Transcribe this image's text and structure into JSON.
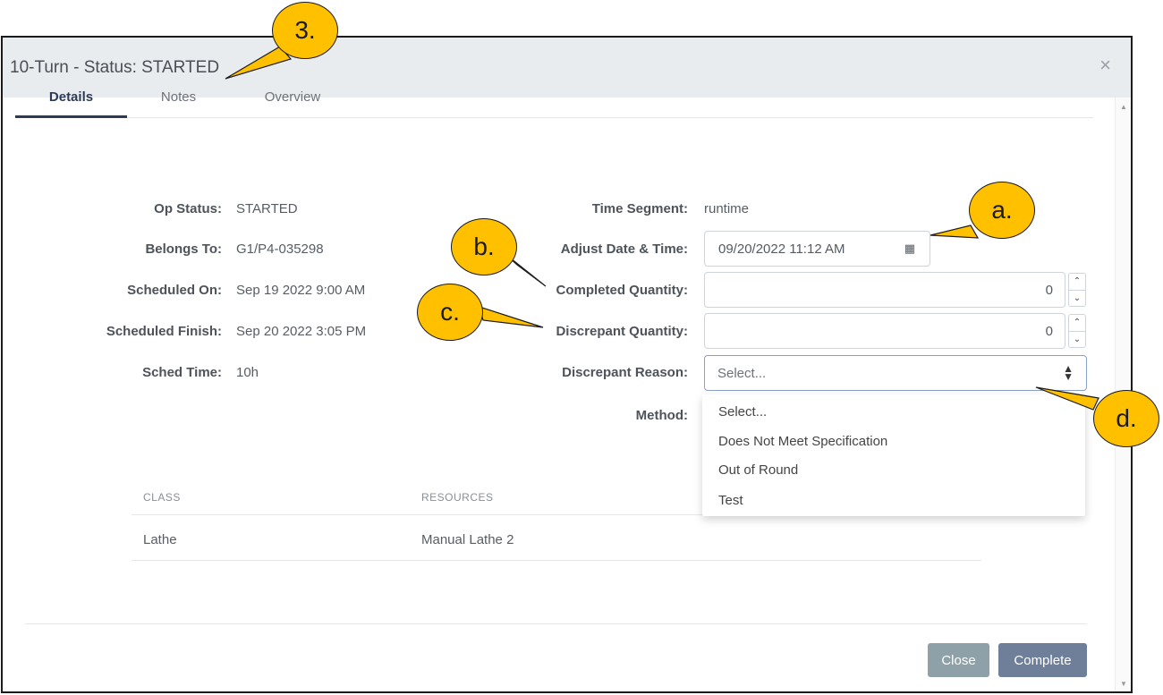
{
  "modal": {
    "title": "10-Turn - Status: STARTED",
    "close_icon": "×"
  },
  "tabs": [
    {
      "label": "Details",
      "active": true
    },
    {
      "label": "Notes",
      "active": false
    },
    {
      "label": "Overview",
      "active": false
    }
  ],
  "details_left": {
    "op_status_label": "Op Status:",
    "op_status_value": "STARTED",
    "belongs_to_label": "Belongs To:",
    "belongs_to_value": "G1/P4-035298",
    "scheduled_on_label": "Scheduled On:",
    "scheduled_on_value": "Sep 19 2022 9:00 AM",
    "scheduled_finish_label": "Scheduled Finish:",
    "scheduled_finish_value": "Sep 20 2022 3:05 PM",
    "sched_time_label": "Sched Time:",
    "sched_time_value": "10h"
  },
  "details_right": {
    "time_segment_label": "Time Segment:",
    "time_segment_value": "runtime",
    "adjust_label": "Adjust Date & Time:",
    "adjust_value": "09/20/2022 11:12 AM",
    "completed_qty_label": "Completed Quantity:",
    "completed_qty_value": "0",
    "discrepant_qty_label": "Discrepant Quantity:",
    "discrepant_qty_value": "0",
    "discrepant_reason_label": "Discrepant Reason:",
    "discrepant_reason_value": "Select...",
    "method_label": "Method:"
  },
  "dropdown_options": [
    "Select...",
    "Does Not Meet Specification",
    "Out of Round",
    "Test"
  ],
  "table": {
    "headers": [
      "CLASS",
      "RESOURCES"
    ],
    "rows": [
      [
        "Lathe",
        "Manual Lathe 2"
      ]
    ]
  },
  "footer": {
    "close_label": "Close",
    "complete_label": "Complete"
  },
  "callouts": {
    "c3": "3.",
    "ca": "a.",
    "cb": "b.",
    "cc": "c.",
    "cd": "d."
  },
  "colors": {
    "callout": "#ffc000",
    "close_button": "#8fa1a8",
    "complete_button": "#6f7f9a",
    "active_tab": "#2c3a55"
  }
}
